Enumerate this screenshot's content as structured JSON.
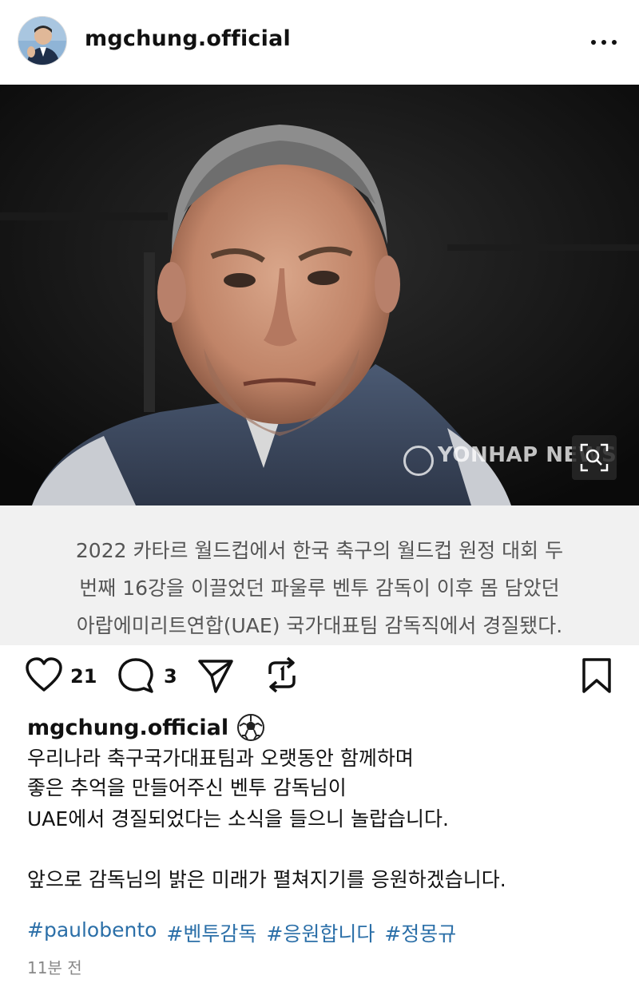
{
  "header": {
    "username": "mgchung.official"
  },
  "image": {
    "watermark": "YONHAP NEWS"
  },
  "caption_box": {
    "lines": [
      "2022 카타르 월드컵에서 한국 축구의 월드컵 원정 대회 두",
      "번째 16강을 이끌었던 파울루 벤투 감독이 이후 몸 담았던",
      "아랍에미리트연합(UAE) 국가대표팀 감독직에서 경질됐다."
    ]
  },
  "actions": {
    "like_count": "21",
    "comment_count": "3"
  },
  "post": {
    "author": "mgchung.official",
    "author_emoji": "soccer-ball-icon",
    "lines": [
      "우리나라 축구국가대표팀과 오랫동안 함께하며",
      "좋은 추억을 만들어주신 벤투 감독님이",
      "UAE에서 경질되었다는 소식을 들으니 놀랍습니다.",
      "앞으로 감독님의 밝은 미래가 펼쳐지기를 응원하겠습니다."
    ],
    "hashtags": [
      "#paulobento",
      "#벤투감독",
      "#응원합니다",
      "#정몽규"
    ],
    "timestamp": "11분 전"
  },
  "colors": {
    "hashtag": "#2b6fa8",
    "caption_bg": "#f1f1f1",
    "caption_text": "#555555"
  }
}
